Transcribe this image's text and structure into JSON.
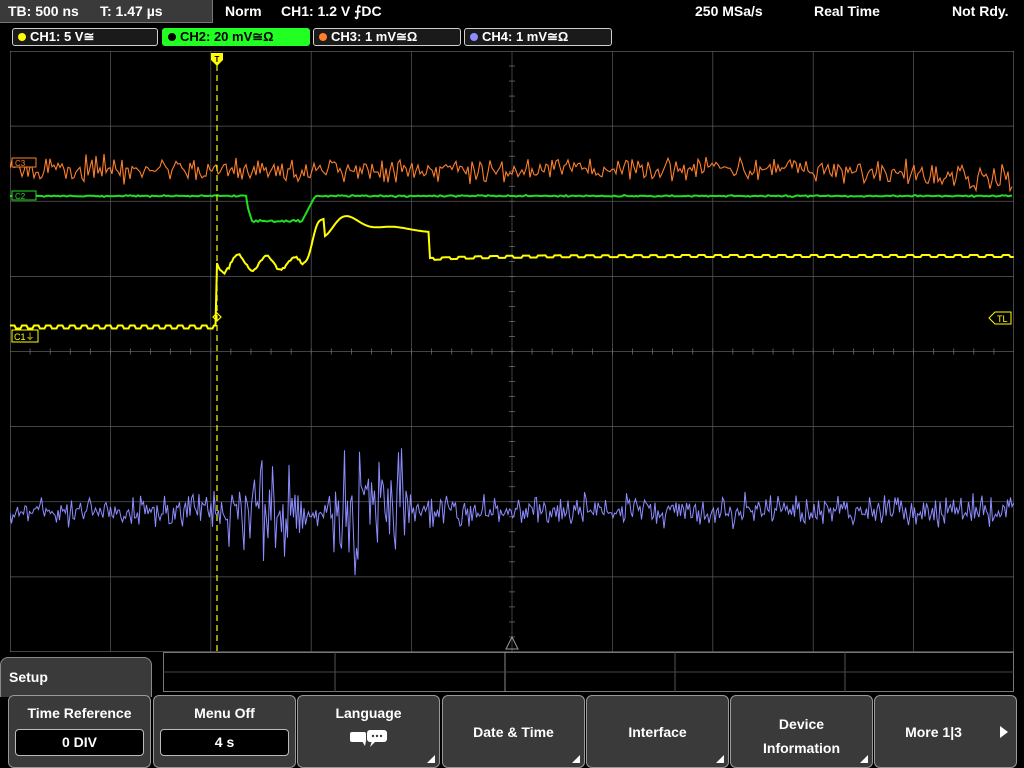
{
  "topbar": {
    "timebase": "TB: 500 ns",
    "trigger_time": "T: 1.47 µs",
    "trigger_mode": "Norm",
    "trigger_info": "CH1: 1.2 V ⨍DC",
    "sample_rate": "250 MSa/s",
    "acq_mode": "Real Time",
    "status": "Not Rdy."
  },
  "channels": [
    {
      "label": "CH1: 5 V≅",
      "color": "#ffff00"
    },
    {
      "label": "CH2: 20 mV≅Ω",
      "color": "#22dd22",
      "active": true
    },
    {
      "label": "CH3: 1 mV≅Ω",
      "color": "#ff7f2a"
    },
    {
      "label": "CH4: 1 mV≅Ω",
      "color": "#8c8cff"
    }
  ],
  "markers": {
    "ch1_ref": "C1⏚",
    "trigger_level": "TL",
    "ch2_ref": "C2",
    "ch3_ref": "C3"
  },
  "menu": {
    "title": "Setup",
    "softkeys": [
      {
        "title": "Time Reference",
        "value": "0 DIV"
      },
      {
        "title": "Menu Off",
        "value": "4 s"
      },
      {
        "title": "Language",
        "icon": "speech-bubble-icon"
      },
      {
        "title": "Date & Time"
      },
      {
        "title": "Interface"
      },
      {
        "title": "Device Information"
      },
      {
        "title": "More 1|3",
        "icon": "play-arrow-icon"
      }
    ]
  },
  "colors": {
    "ch1": "#ffff00",
    "ch2": "#22dd22",
    "ch3": "#ff7f2a",
    "ch4": "#8c8cff",
    "grid": "#5a5a5a",
    "trigger_line": "#ffff00"
  }
}
